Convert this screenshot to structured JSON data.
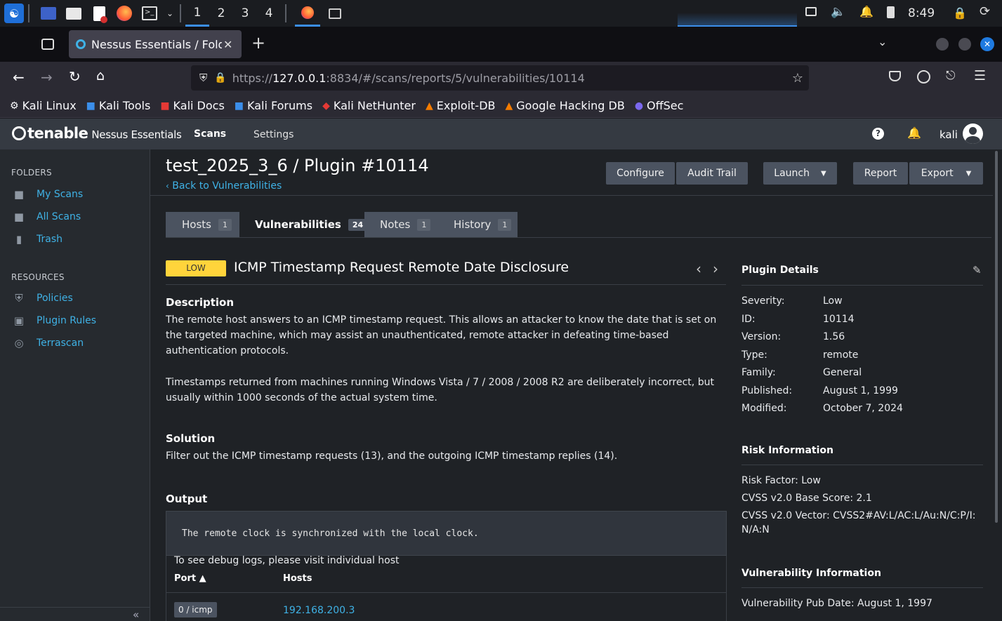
{
  "taskbar": {
    "workspaces": [
      "1",
      "2",
      "3",
      "4"
    ],
    "clock": "8:49"
  },
  "browser": {
    "tab_title": "Nessus Essentials / Folde",
    "url_prefix": "https://",
    "url_host": "127.0.0.1",
    "url_rest": ":8834/#/scans/reports/5/vulnerabilities/10114",
    "bookmarks": [
      "Kali Linux",
      "Kali Tools",
      "Kali Docs",
      "Kali Forums",
      "Kali NetHunter",
      "Exploit-DB",
      "Google Hacking DB",
      "OffSec"
    ]
  },
  "app": {
    "brand": "tenable",
    "product": "Nessus Essentials",
    "nav_scans": "Scans",
    "nav_settings": "Settings",
    "user": "kali"
  },
  "sidebar": {
    "folders_heading": "FOLDERS",
    "folders": [
      "My Scans",
      "All Scans",
      "Trash"
    ],
    "resources_heading": "RESOURCES",
    "resources": [
      "Policies",
      "Plugin Rules",
      "Terrascan"
    ]
  },
  "page": {
    "title": "test_2025_3_6 / Plugin #10114",
    "back_link": "Back to Vulnerabilities",
    "buttons": {
      "configure": "Configure",
      "audit": "Audit Trail",
      "launch": "Launch",
      "report": "Report",
      "export": "Export"
    },
    "tabs": [
      {
        "label": "Hosts",
        "count": "1"
      },
      {
        "label": "Vulnerabilities",
        "count": "24"
      },
      {
        "label": "Notes",
        "count": "1"
      },
      {
        "label": "History",
        "count": "1"
      }
    ]
  },
  "vuln": {
    "severity": "LOW",
    "name": "ICMP Timestamp Request Remote Date Disclosure",
    "description_heading": "Description",
    "description_1": "The remote host answers to an ICMP timestamp request. This allows an attacker to know the date that is set on the targeted machine, which may assist an unauthenticated, remote attacker in defeating time-based authentication protocols.",
    "description_2": "Timestamps returned from machines running Windows Vista / 7 / 2008 / 2008 R2 are deliberately incorrect, but usually within 1000 seconds of the actual system time.",
    "solution_heading": "Solution",
    "solution": "Filter out the ICMP timestamp requests (13), and the outgoing ICMP timestamp replies (14).",
    "output_heading": "Output",
    "output_text": "The remote clock is synchronized with the local clock.",
    "debug_note": "To see debug logs, please visit individual host",
    "port_header": "Port ▲",
    "hosts_header": "Hosts",
    "port_value": "0 / icmp",
    "host_value": "192.168.200.3"
  },
  "plugin_details": {
    "heading": "Plugin Details",
    "rows": [
      {
        "k": "Severity:",
        "v": "Low"
      },
      {
        "k": "ID:",
        "v": "10114"
      },
      {
        "k": "Version:",
        "v": "1.56"
      },
      {
        "k": "Type:",
        "v": "remote"
      },
      {
        "k": "Family:",
        "v": "General"
      },
      {
        "k": "Published:",
        "v": "August 1, 1999"
      },
      {
        "k": "Modified:",
        "v": "October 7, 2024"
      }
    ]
  },
  "risk": {
    "heading": "Risk Information",
    "factor": "Risk Factor: Low",
    "base": "CVSS v2.0 Base Score: 2.1",
    "vector": "CVSS v2.0 Vector: CVSS2#AV:L/AC:L/Au:N/C:P/I:N/A:N"
  },
  "vuln_info": {
    "heading": "Vulnerability Information",
    "pub": "Vulnerability Pub Date: August 1, 1997"
  },
  "colors": {
    "accent": "#3fb2e6",
    "low_badge": "#ffd43b",
    "panel": "#1f2226"
  }
}
